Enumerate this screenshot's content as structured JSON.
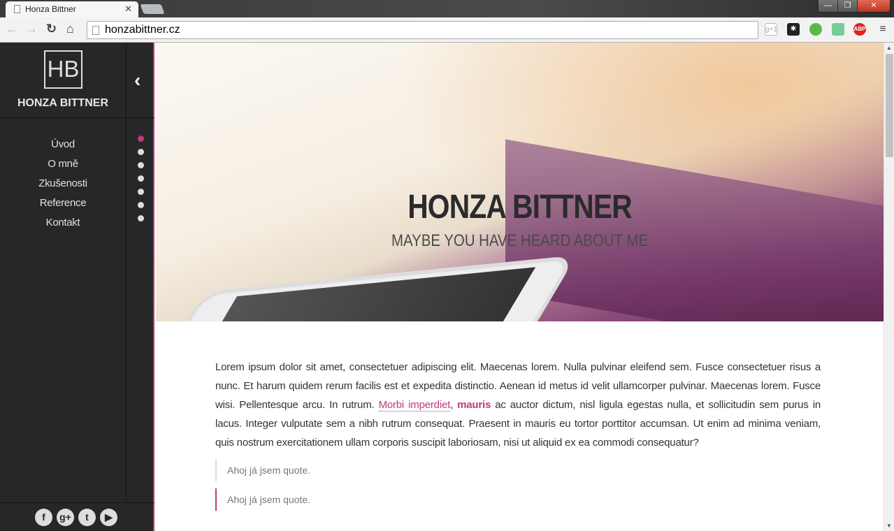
{
  "browser": {
    "tab_title": "Honza Bittner",
    "url": "honzabittner.cz",
    "extensions": [
      "google-plus-one-icon",
      "asterisk-icon",
      "evernote-icon",
      "screen-icon",
      "adblock-plus-icon"
    ],
    "abp_label": "ABP",
    "gplus_label": "g+1"
  },
  "sidebar": {
    "logo": "HB",
    "brand": "HONZA BITTNER",
    "menu": [
      {
        "label": "Úvod"
      },
      {
        "label": "O mně"
      },
      {
        "label": "Zkušenosti"
      },
      {
        "label": "Reference"
      },
      {
        "label": "Kontakt"
      }
    ],
    "active_dot": 0,
    "dot_count": 7,
    "social": [
      "facebook-icon",
      "google-plus-icon",
      "twitter-icon",
      "youtube-icon"
    ]
  },
  "hero": {
    "title": "HONZA BITTNER",
    "subtitle": "MAYBE YOU HAVE HEARD ABOUT ME"
  },
  "content": {
    "p_before": "Lorem ipsum dolor sit amet, consectetuer adipiscing elit. Maecenas lorem. Nulla pulvinar eleifend sem. Fusce consectetuer risus a nunc. Et harum quidem rerum facilis est et expedita distinctio. Aenean id metus id velit ullamcorper pulvinar. Maecenas lorem. Fusce wisi. Pellentesque arcu. In rutrum. ",
    "link": "Morbi imperdiet",
    "comma": ", ",
    "bold": "mauris",
    "p_after": " ac auctor dictum, nisl ligula egestas nulla, et sollicitudin sem purus in lacus. Integer vulputate sem a nibh rutrum consequat. Praesent in mauris eu tortor porttitor accumsan. Ut enim ad minima veniam, quis nostrum exercitationem ullam corporis suscipit laboriosam, nisi ut aliquid ex ea commodi consequatur?",
    "quotes": [
      "Ahoj já jsem quote.",
      "Ahoj já jsem quote."
    ]
  },
  "colors": {
    "accent": "#c0397f",
    "sidebar": "#272727"
  }
}
